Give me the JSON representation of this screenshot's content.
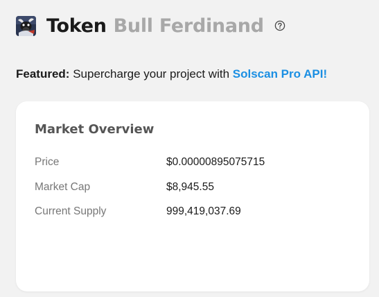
{
  "header": {
    "title": "Token",
    "token_name": "Bull Ferdinand",
    "logo_icon": "bull-token-logo",
    "help_icon": "question-circle-icon"
  },
  "featured": {
    "label": "Featured:",
    "text": " Supercharge your project with ",
    "link_text": "Solscan Pro API!",
    "link_color": "#1b8fe3"
  },
  "market_overview": {
    "title": "Market Overview",
    "rows": [
      {
        "label": "Price",
        "value": "$0.00000895075715"
      },
      {
        "label": "Market Cap",
        "value": "$8,945.55"
      },
      {
        "label": "Current Supply",
        "value": "999,419,037.69"
      }
    ]
  }
}
